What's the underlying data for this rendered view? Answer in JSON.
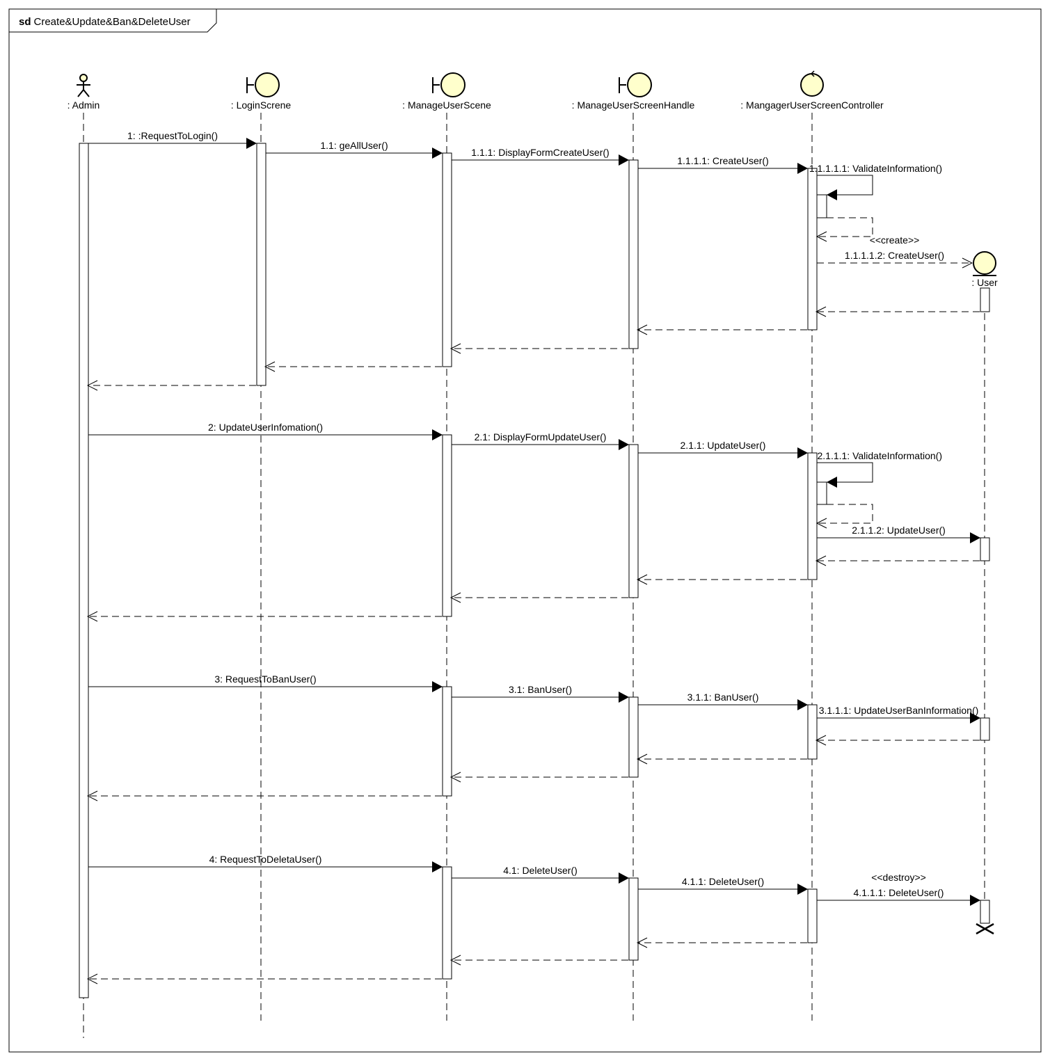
{
  "frame": {
    "keyword": "sd",
    "name": "Create&Update&Ban&DeleteUser"
  },
  "participants": [
    {
      "id": "admin",
      "label": ": Admin",
      "kind": "actor"
    },
    {
      "id": "login",
      "label": ": LoginScrene",
      "kind": "boundary"
    },
    {
      "id": "mus",
      "label": ": ManageUserScene",
      "kind": "boundary"
    },
    {
      "id": "mush",
      "label": ": ManageUserScreenHandle",
      "kind": "boundary"
    },
    {
      "id": "ctrl",
      "label": ": MangagerUserScreenController",
      "kind": "control"
    },
    {
      "id": "user",
      "label": ": User",
      "kind": "entity"
    }
  ],
  "colors": {
    "element_fill": "#FFFFCC",
    "line": "#000000"
  },
  "messages": [
    {
      "from": "admin",
      "to": "login",
      "type": "sync",
      "label": "1: :RequestToLogin()"
    },
    {
      "from": "login",
      "to": "mus",
      "type": "sync",
      "label": "1.1: geAllUser()"
    },
    {
      "from": "mus",
      "to": "mush",
      "type": "sync",
      "label": "1.1.1: DisplayFormCreateUser()"
    },
    {
      "from": "mush",
      "to": "ctrl",
      "type": "sync",
      "label": "1.1.1.1: CreateUser()"
    },
    {
      "from": "ctrl",
      "to": "ctrl",
      "type": "self",
      "label": "1.1.1.1.1: ValidateInformation()"
    },
    {
      "from": "ctrl",
      "to": "user",
      "type": "create",
      "label": "1.1.1.1.2: CreateUser()",
      "stereotype": "<<create>>"
    },
    {
      "from": "user",
      "to": "ctrl",
      "type": "return",
      "label": ""
    },
    {
      "from": "ctrl",
      "to": "mush",
      "type": "return",
      "label": ""
    },
    {
      "from": "mush",
      "to": "mus",
      "type": "return",
      "label": ""
    },
    {
      "from": "mus",
      "to": "login",
      "type": "return",
      "label": ""
    },
    {
      "from": "login",
      "to": "admin",
      "type": "return",
      "label": ""
    },
    {
      "from": "admin",
      "to": "mus",
      "type": "sync",
      "label": "2: UpdateUserInfomation()"
    },
    {
      "from": "mus",
      "to": "mush",
      "type": "sync",
      "label": "2.1: DisplayFormUpdateUser()"
    },
    {
      "from": "mush",
      "to": "ctrl",
      "type": "sync",
      "label": "2.1.1: UpdateUser()"
    },
    {
      "from": "ctrl",
      "to": "ctrl",
      "type": "self",
      "label": "2.1.1.1: ValidateInformation()"
    },
    {
      "from": "ctrl",
      "to": "user",
      "type": "sync",
      "label": "2.1.1.2: UpdateUser()"
    },
    {
      "from": "user",
      "to": "ctrl",
      "type": "return",
      "label": ""
    },
    {
      "from": "ctrl",
      "to": "mush",
      "type": "return",
      "label": ""
    },
    {
      "from": "mush",
      "to": "mus",
      "type": "return",
      "label": ""
    },
    {
      "from": "mus",
      "to": "admin",
      "type": "return",
      "label": ""
    },
    {
      "from": "admin",
      "to": "mus",
      "type": "sync",
      "label": "3: RequestToBanUser()"
    },
    {
      "from": "mus",
      "to": "mush",
      "type": "sync",
      "label": "3.1: BanUser()"
    },
    {
      "from": "mush",
      "to": "ctrl",
      "type": "sync",
      "label": "3.1.1: BanUser()"
    },
    {
      "from": "ctrl",
      "to": "user",
      "type": "sync",
      "label": "3.1.1.1: UpdateUserBanInformation()"
    },
    {
      "from": "user",
      "to": "ctrl",
      "type": "return",
      "label": ""
    },
    {
      "from": "ctrl",
      "to": "mush",
      "type": "return",
      "label": ""
    },
    {
      "from": "mush",
      "to": "mus",
      "type": "return",
      "label": ""
    },
    {
      "from": "mus",
      "to": "admin",
      "type": "return",
      "label": ""
    },
    {
      "from": "admin",
      "to": "mus",
      "type": "sync",
      "label": "4: RequestToDeletaUser()"
    },
    {
      "from": "mus",
      "to": "mush",
      "type": "sync",
      "label": "4.1: DeleteUser()"
    },
    {
      "from": "mush",
      "to": "ctrl",
      "type": "sync",
      "label": "4.1.1: DeleteUser()"
    },
    {
      "from": "ctrl",
      "to": "user",
      "type": "destroy",
      "label": "4.1.1.1: DeleteUser()",
      "stereotype": "<<destroy>>"
    },
    {
      "from": "ctrl",
      "to": "mush",
      "type": "return",
      "label": ""
    },
    {
      "from": "mush",
      "to": "mus",
      "type": "return",
      "label": ""
    },
    {
      "from": "mus",
      "to": "admin",
      "type": "return",
      "label": ""
    }
  ]
}
